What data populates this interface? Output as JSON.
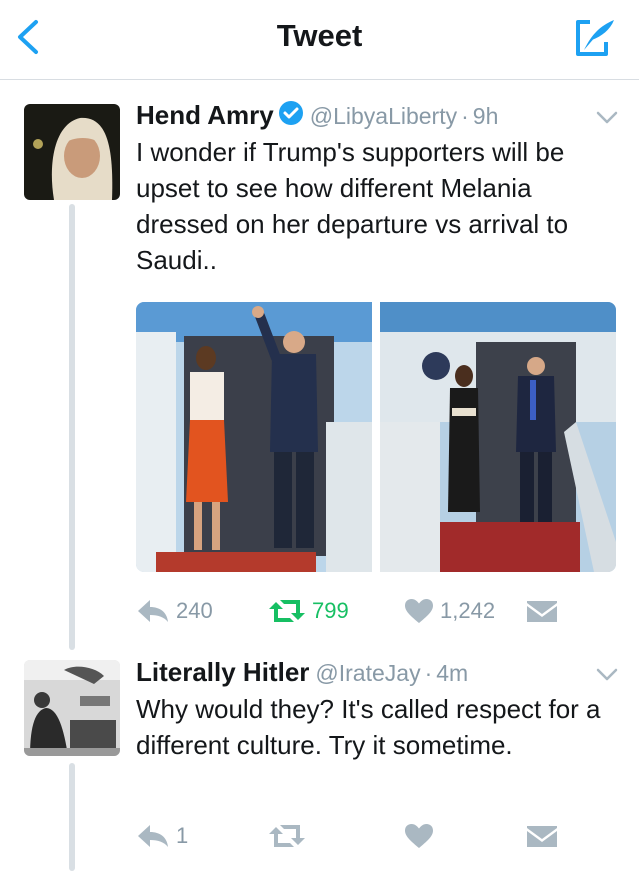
{
  "header": {
    "title": "Tweet"
  },
  "tweets": [
    {
      "name": "Hend Amry",
      "handle": "@LibyaLiberty",
      "time": "9h",
      "text": "I wonder if Trump's supporters will be upset to see how different Melania dressed on her departure vs arrival to Saudi..",
      "replies": "240",
      "retweets": "799",
      "likes": "1,242"
    },
    {
      "name": "Literally Hitler",
      "handle": "@IrateJay",
      "time": "4m",
      "text": "Why would they? It's called respect for a different culture. Try it sometime.",
      "replies": "1"
    }
  ],
  "colors": {
    "accent": "#1da1f2",
    "retweet": "#17bf63",
    "muted": "#8899a6"
  }
}
